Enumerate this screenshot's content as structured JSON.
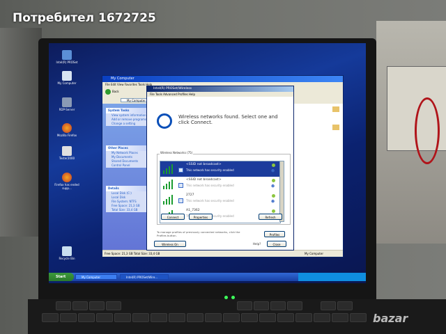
{
  "banner": {
    "text": "Потребител 1672725"
  },
  "watermark": {
    "text": "bazar"
  },
  "desktop_icons": [
    {
      "label": "Intel(R) PROSet",
      "icon": "network-icon"
    },
    {
      "label": "My Computer",
      "icon": "computer-icon"
    },
    {
      "label": "RDP-Server",
      "icon": "server-icon"
    },
    {
      "label": "Mozilla Firefox",
      "icon": "firefox-icon"
    },
    {
      "label": "Tester2000",
      "icon": "tool-icon"
    },
    {
      "label": "Firefox has ended supp...",
      "icon": "firefox-icon"
    },
    {
      "label": "Recycle Bin",
      "icon": "recycle-bin-icon"
    }
  ],
  "explorer": {
    "title": "My Computer",
    "menu": "File   Edit   View   Favorites   Tools   Help",
    "back_label": "Back",
    "address": "My Computer",
    "system_tasks": {
      "header": "System Tasks",
      "items": [
        "View system information",
        "Add or remove programs",
        "Change a setting"
      ]
    },
    "other_places": {
      "header": "Other Places",
      "items": [
        "My Network Places",
        "My Documents",
        "Shared Documents",
        "Control Panel"
      ]
    },
    "details": {
      "header": "Details",
      "items": [
        "Local Disk (C:)",
        "Local Disk",
        "File System: NTFS",
        "Free Space: 21,3 GB",
        "Total Size: 33,4 GB"
      ]
    },
    "status": "Free Space: 21,3 GB  Total Size: 33,4 GB",
    "status_right": "My Computer"
  },
  "wifi": {
    "title": "Intel(R) PROSet/Wireless",
    "menu": "File   Tools   Advanced   Profiles   Help",
    "message": "Wireless networks found. Select one and click Connect.",
    "group_label": "Wireless Networks (75)",
    "networks": [
      {
        "name": "<SSID not broadcast>",
        "desc": "This network has security enabled"
      },
      {
        "name": "<SSID not broadcast>",
        "desc": "This network has security enabled"
      },
      {
        "name": "2727",
        "desc": "This network has security enabled"
      },
      {
        "name": "A1_7362",
        "desc": "This network has security enabled"
      }
    ],
    "connect_label": "Connect",
    "properties_label": "Properties",
    "refresh_label": "Refresh",
    "hint": "To manage profiles of previously connected networks, click the Profiles button.",
    "profiles_label": "Profiles",
    "wireless_on_label": "Wireless On",
    "help_label": "Help?",
    "close_label": "Close"
  },
  "taskbar": {
    "start_label": "Start",
    "tasks": [
      "My Computer",
      "Intel(R) PROSet/Wire..."
    ]
  },
  "colors": {
    "desktop": "#153a9a",
    "titlebar": "#0a3fc0",
    "signal": "#1a9c2f",
    "selection": "#1c3c9c"
  }
}
